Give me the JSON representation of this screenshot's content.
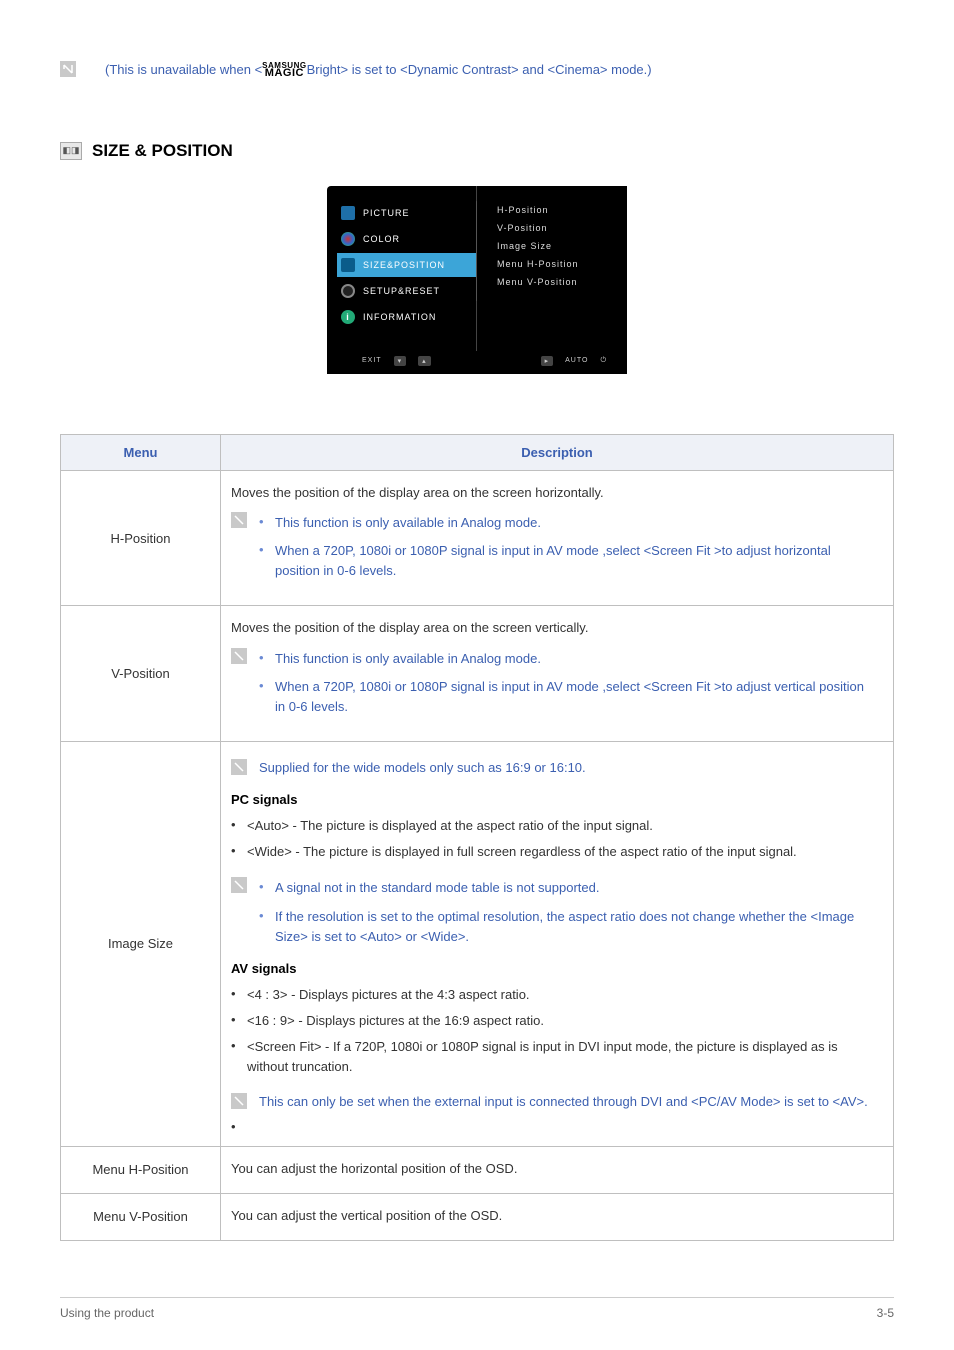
{
  "top_note": {
    "prefix": "(This is unavailable when <",
    "brand_top": "SAMSUNG",
    "brand_bottom": "MAGIC",
    "suffix": "Bright> is set to <Dynamic Contrast> and <Cinema> mode.)"
  },
  "section_title": "SIZE & POSITION",
  "osd": {
    "left": [
      "PICTURE",
      "COLOR",
      "SIZE&POSITION",
      "SETUP&RESET",
      "INFORMATION"
    ],
    "right": [
      "H-Position",
      "V-Position",
      "Image Size",
      "Menu H-Position",
      "Menu V-Position"
    ],
    "bottom_left": [
      "EXIT",
      "▾",
      "▴"
    ],
    "bottom_right": [
      "▸",
      "AUTO",
      "⏻"
    ]
  },
  "table": {
    "headers": {
      "menu": "Menu",
      "desc": "Description"
    },
    "rows": {
      "hpos": {
        "label": "H-Position",
        "intro": "Moves the position of the display area on the screen horizontally.",
        "bullets": [
          "This function is only available in Analog mode.",
          "When a 720P, 1080i or 1080P signal is input in AV mode ,select <Screen Fit  >to adjust horizontal position in 0-6 levels."
        ]
      },
      "vpos": {
        "label": "V-Position",
        "intro": "Moves the position of the display area on the screen vertically.",
        "bullets": [
          "This function is only available in Analog mode.",
          "When a 720P, 1080i or 1080P signal is input in AV mode ,select <Screen Fit  >to adjust vertical position in 0-6 levels."
        ]
      },
      "imgsize": {
        "label": "Image Size",
        "top_note": "Supplied for the wide models only such as 16:9 or 16:10.",
        "pc_heading": "PC signals",
        "pc_bullets": [
          "<Auto> - The picture is displayed at the aspect ratio of the input signal.",
          "<Wide> - The picture is displayed in full screen regardless of the aspect ratio of the input signal."
        ],
        "pc_notes": [
          "A signal not in the standard mode table is not supported.",
          "If the resolution is set to the optimal resolution, the aspect ratio does not change whether the <Image Size> is set to <Auto> or <Wide>."
        ],
        "av_heading": "AV signals",
        "av_bullets": [
          "<4 : 3> - Displays pictures at the 4:3 aspect ratio.",
          "<16 : 9> - Displays pictures at the 16:9 aspect ratio.",
          "<Screen Fit> - If a 720P, 1080i or 1080P signal is input in DVI input mode, the picture is displayed as is without truncation."
        ],
        "av_note": "This can only be set when the external input is connected through DVI and <PC/AV Mode> is set to <AV>."
      },
      "menuh": {
        "label": "Menu H-Position",
        "desc": "You can adjust the horizontal position of the OSD."
      },
      "menuv": {
        "label": "Menu V-Position",
        "desc": "You can adjust the vertical position of the OSD."
      }
    }
  },
  "footer": {
    "left": "Using the product",
    "right": "3-5"
  },
  "chart_data": {
    "type": "table",
    "title": "SIZE & POSITION menu descriptions",
    "columns": [
      "Menu",
      "Description"
    ],
    "rows": [
      [
        "H-Position",
        "Moves the position of the display area on the screen horizontally. Only in Analog mode. For 720P/1080i/1080P in AV mode select <Screen Fit> to adjust horizontal position in 0-6 levels."
      ],
      [
        "V-Position",
        "Moves the position of the display area on the screen vertically. Only in Analog mode. For 720P/1080i/1080P in AV mode select <Screen Fit> to adjust vertical position in 0-6 levels."
      ],
      [
        "Image Size",
        "Wide models (16:9/16:10) only. PC signals: <Auto> keeps input aspect ratio, <Wide> fills screen; non-standard modes unsupported; at optimal resolution aspect doesn't change. AV signals: <4:3>, <16:9>, <Screen Fit> (720P/1080i/1080P via DVI, no truncation). Settable only when external input is DVI and <PC/AV Mode> is <AV>."
      ],
      [
        "Menu H-Position",
        "You can adjust the horizontal position of the OSD."
      ],
      [
        "Menu V-Position",
        "You can adjust the vertical position of the OSD."
      ]
    ]
  }
}
